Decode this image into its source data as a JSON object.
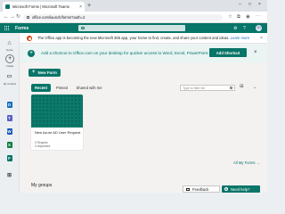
{
  "browser": {
    "tab_title": "Microsoft Forms | Microsoft Teams",
    "tab_close": "×",
    "new_tab": "+",
    "url": "office.com/launch/forms?auth=2",
    "window_controls": [
      "–",
      "□",
      "×"
    ]
  },
  "appbar": {
    "app_name": "Forms",
    "avatar_initials": "JD"
  },
  "banner": {
    "message": "The Office app is becoming the new Microsoft 365 app, your home to find, create, and share your content and ideas.",
    "link_text": "Learn more"
  },
  "shortcut_banner": {
    "message": "Add a shortcut to Office.com on your desktop for quicker access to Word, Excel, PowerPoint.",
    "button_label": "Add Shortcut",
    "plus": "+"
  },
  "new_form_button": {
    "label": "New Form",
    "plus": "+"
  },
  "forms_tabs": {
    "items": [
      {
        "label": "Recent",
        "active": true
      },
      {
        "label": "Pinned",
        "active": false
      },
      {
        "label": "Shared with me",
        "active": false
      }
    ],
    "filter_placeholder": "Type to filter list"
  },
  "form_card": {
    "title": "New Azure AD User Request",
    "responses": "0 Request",
    "meta": "0 responses"
  },
  "all_my_forms_link": "All My Forms →",
  "my_groups_heading": "My groups",
  "footer": {
    "feedback_label": "Feedback",
    "need_help_label": "Need help?"
  },
  "rail": {
    "items": [
      {
        "label": "Home",
        "icon": "home-icon"
      },
      {
        "label": "Create",
        "icon": "plus-icon"
      },
      {
        "label": "My Content",
        "icon": "folder-icon"
      },
      {
        "label": "Outlook",
        "icon": "outlook-icon"
      },
      {
        "label": "Teams",
        "icon": "teams-icon"
      },
      {
        "label": "Word",
        "icon": "word-icon"
      },
      {
        "label": "Excel",
        "icon": "excel-icon"
      },
      {
        "label": "Forms",
        "icon": "forms-icon"
      },
      {
        "label": "Apps",
        "icon": "apps-icon"
      }
    ]
  },
  "colors": {
    "accent": "#077568",
    "outlook": "#0f6cbd",
    "teams": "#5b5fc7",
    "word": "#185abd",
    "excel": "#107c41",
    "forms": "#077568"
  }
}
